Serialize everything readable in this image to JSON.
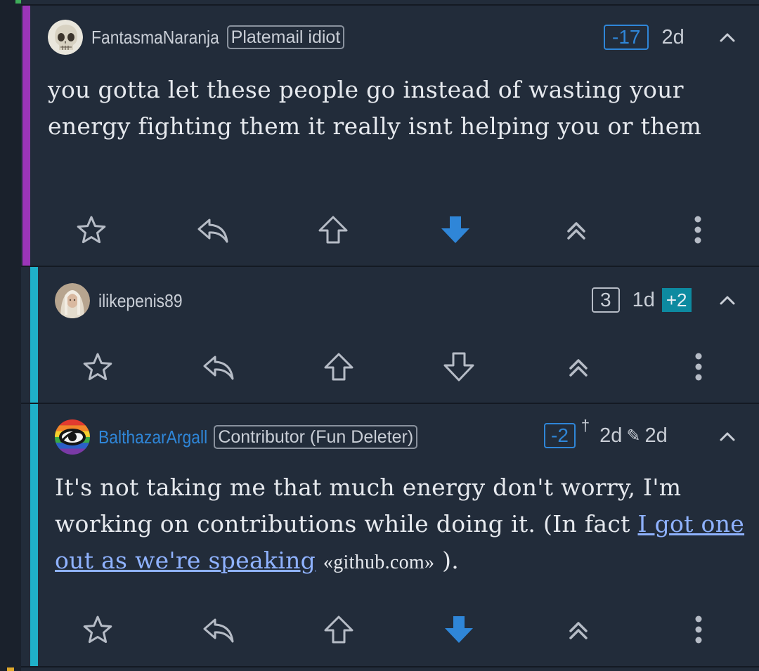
{
  "comments": [
    {
      "username": "FantasmaNaranja",
      "flair": "Platemail idiot",
      "score": "-17",
      "age": "2d",
      "body": "you gotta let these people go instead of wasting your energy fighting them it really isnt helping you or them",
      "vote_state": "downvoted",
      "bar_color": "#9b35b8",
      "avatar": "skull-avatar"
    },
    {
      "username": "ilikepenis89",
      "score": "3",
      "age": "1d",
      "new_badge": "+2",
      "vote_state": "none",
      "bar_color": "#1fb0c9",
      "avatar": "portrait-avatar"
    },
    {
      "username": "BalthazarArgall",
      "flair": "Contributor (Fun Deleter)",
      "score": "-2",
      "dagger": "†",
      "age": "2d",
      "edited_age": "2d",
      "body_parts": {
        "before": "It's not taking me that much energy don't worry, I'm working on contributions while doing it. (In fact ",
        "link": "I got one out as we're speaking",
        "domain": "«github.com»",
        "after": " )."
      },
      "vote_state": "downvoted",
      "bar_color": "#1fb0c9",
      "avatar": "rainbow-eye-avatar"
    }
  ],
  "actions": [
    "star-icon",
    "reply-icon",
    "upvote-icon",
    "downvote-icon",
    "parent-icon",
    "more-icon"
  ],
  "colors": {
    "background": "#222c3a",
    "accent_blue": "#2f86d8",
    "link": "#8fb2ff",
    "text": "#e6e9ee",
    "icon": "#b6bcc6"
  }
}
